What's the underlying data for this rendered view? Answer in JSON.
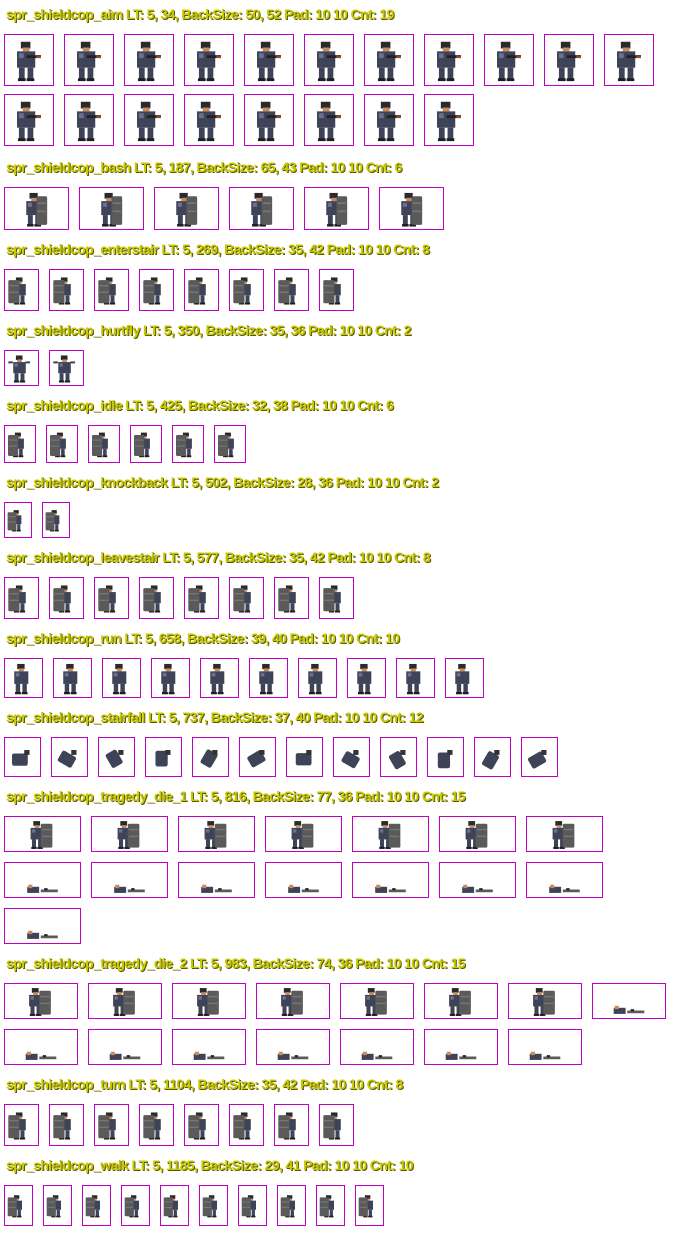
{
  "sheet": {
    "sprites": [
      {
        "label": "spr_shieldcop_aim   LT: 5, 34,  BackSize: 50, 52  Pad: 10 10 Cnt: 19",
        "count": 19,
        "pose": "aim",
        "bg": "#6a4a70"
      },
      {
        "label": "spr_shieldcop_bash  LT: 5, 187,  BackSize: 65, 43  Pad: 10 10 Cnt: 6",
        "count": 6,
        "pose": "bash",
        "bg": "#555a66"
      },
      {
        "label": "spr_shieldcop_enterstair  LT: 5, 269,  BackSize: 35, 42  Pad: 10 10 Cnt: 8",
        "count": 8,
        "pose": "shield",
        "bg": "#4c5060"
      },
      {
        "label": "spr_shieldcop_hurtfly  LT: 5, 350,  BackSize: 35, 36  Pad: 10 10 Cnt: 2",
        "count": 2,
        "pose": "hurt",
        "bg": "#4c5060"
      },
      {
        "label": "spr_shieldcop_idle  LT: 5, 425,  BackSize: 32, 38  Pad: 10 10 Cnt: 6",
        "count": 6,
        "pose": "shield",
        "bg": "#4c5060"
      },
      {
        "label": "spr_shieldcop_knockback  LT: 5, 502,  BackSize: 28, 36  Pad: 10 10 Cnt: 2",
        "count": 2,
        "pose": "shield",
        "bg": "#4c5060"
      },
      {
        "label": "spr_shieldcop_leavestair  LT: 5, 577,  BackSize: 35, 42  Pad: 10 10 Cnt: 8",
        "count": 8,
        "pose": "shield",
        "bg": "#4c5060"
      },
      {
        "label": "spr_shieldcop_run  LT: 5, 658,  BackSize: 39, 40  Pad: 10 10 Cnt: 10",
        "count": 10,
        "pose": "run",
        "bg": "#4c5060"
      },
      {
        "label": "spr_shieldcop_stairfall  LT: 5, 737,  BackSize: 37, 40  Pad: 10 10 Cnt: 12",
        "count": 12,
        "pose": "fall",
        "bg": "#4c5060"
      },
      {
        "label": "spr_shieldcop_tragedy_die_1  LT: 5, 816,  BackSize: 77, 36  Pad: 10 10 Cnt: 15",
        "count": 15,
        "pose": "die",
        "bg": "#4c5060"
      },
      {
        "label": "spr_shieldcop_tragedy_die_2  LT: 5, 983,  BackSize: 74, 36  Pad: 10 10 Cnt: 15",
        "count": 15,
        "pose": "die",
        "bg": "#4c5060"
      },
      {
        "label": "spr_shieldcop_turn  LT: 5, 1104,  BackSize: 35, 42  Pad: 10 10 Cnt: 8",
        "count": 8,
        "pose": "shield",
        "bg": "#4c5060"
      },
      {
        "label": "spr_shieldcop_walk  LT: 5, 1185,  BackSize: 29, 41  Pad: 10 10 Cnt: 10",
        "count": 10,
        "pose": "walk",
        "bg": "#4c5060"
      }
    ]
  },
  "colors": {
    "label_text": "#c8c800",
    "frame_border": "#c000c0",
    "background": "#ffffff",
    "armor": "#3e4358",
    "armor_light": "#6a7090",
    "shield": "#5a5a5a",
    "skin": "#c98a5a"
  }
}
